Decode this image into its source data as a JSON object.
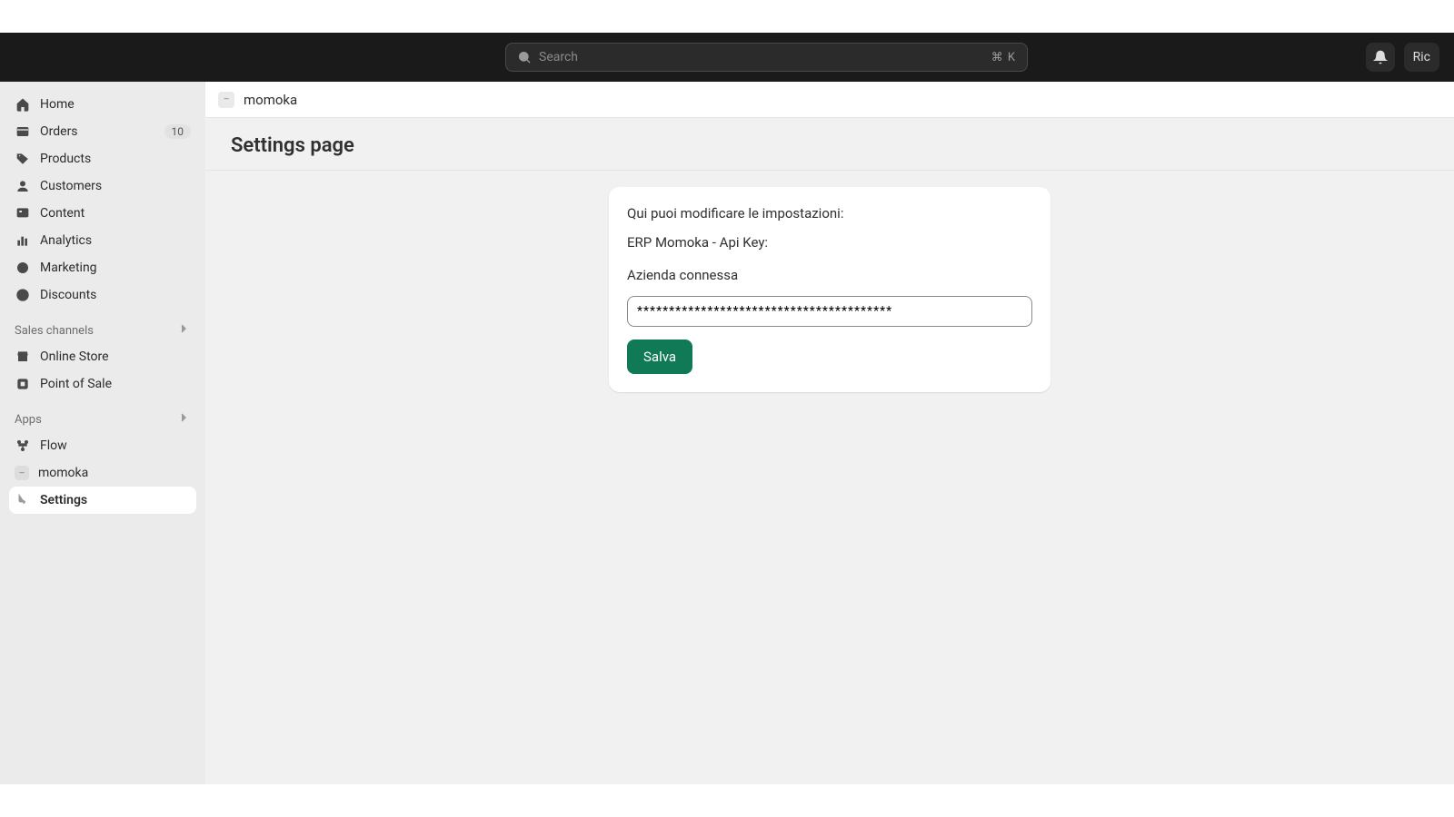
{
  "header": {
    "search_placeholder": "Search",
    "search_shortcut": "⌘ K",
    "user_label": "Ric"
  },
  "sidebar": {
    "items": [
      {
        "icon": "home",
        "label": "Home",
        "badge": ""
      },
      {
        "icon": "orders",
        "label": "Orders",
        "badge": "10"
      },
      {
        "icon": "products",
        "label": "Products",
        "badge": ""
      },
      {
        "icon": "customers",
        "label": "Customers",
        "badge": ""
      },
      {
        "icon": "content",
        "label": "Content",
        "badge": ""
      },
      {
        "icon": "analytics",
        "label": "Analytics",
        "badge": ""
      },
      {
        "icon": "marketing",
        "label": "Marketing",
        "badge": ""
      },
      {
        "icon": "discounts",
        "label": "Discounts",
        "badge": ""
      }
    ],
    "sales_channels_label": "Sales channels",
    "channels": [
      {
        "icon": "onlinestore",
        "label": "Online Store"
      },
      {
        "icon": "pos",
        "label": "Point of Sale"
      }
    ],
    "apps_label": "Apps",
    "apps": [
      {
        "icon": "flow",
        "label": "Flow"
      },
      {
        "icon": "momoka",
        "label": "momoka"
      }
    ],
    "app_subitem": "Settings"
  },
  "crumb": {
    "app_name": "momoka"
  },
  "page": {
    "title": "Settings page",
    "card": {
      "intro": "Qui puoi modificare le impostazioni:",
      "api_key_label": "ERP Momoka - Api Key:",
      "company_label": "Azienda connessa",
      "api_key_value": "****************************************",
      "save_label": "Salva"
    }
  }
}
